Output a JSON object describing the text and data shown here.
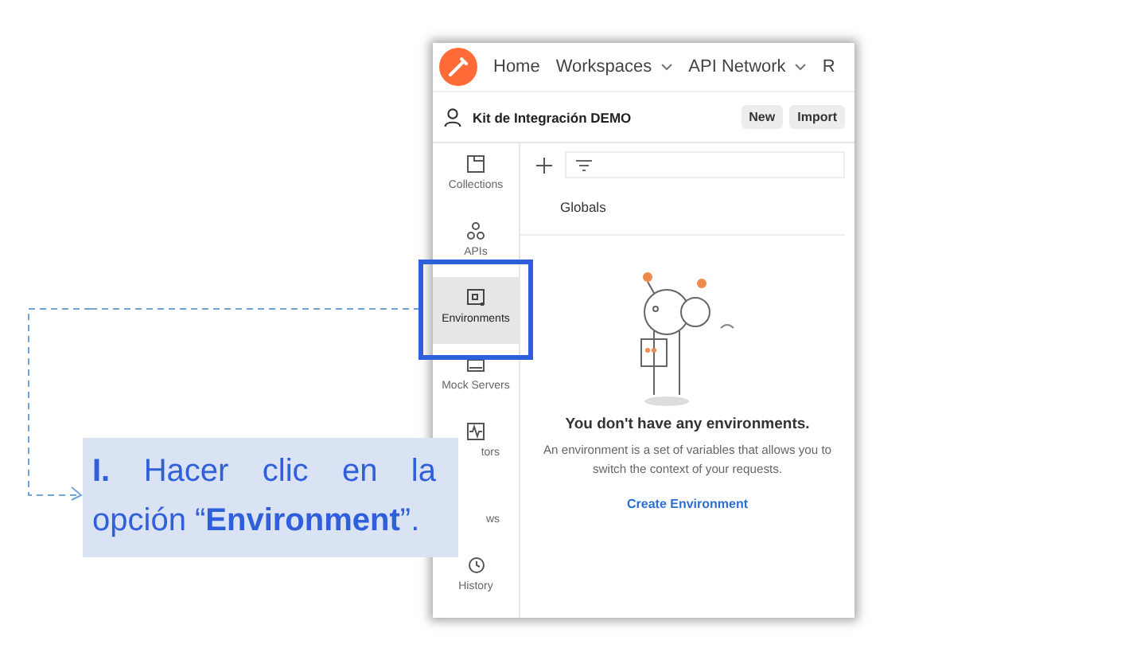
{
  "nav": [
    {
      "label": "Home",
      "dropdown": false
    },
    {
      "label": "Workspaces",
      "dropdown": true
    },
    {
      "label": "API Network",
      "dropdown": true
    },
    {
      "label": "R",
      "dropdown": false
    }
  ],
  "workspace": {
    "name": "Kit de Integración DEMO",
    "buttons": [
      "New",
      "Import"
    ]
  },
  "sidebar": {
    "items": [
      {
        "kind": "full",
        "label": "Collections",
        "selected": false
      },
      {
        "kind": "full",
        "label": "APIs",
        "selected": false
      },
      {
        "kind": "full",
        "label": "Environments",
        "selected": true
      },
      {
        "kind": "full",
        "label": "Mock Servers",
        "selected": false
      },
      {
        "kind": "partial",
        "label": "tors"
      },
      {
        "kind": "partial",
        "label": "ws"
      },
      {
        "kind": "full",
        "label": "History",
        "selected": false
      }
    ]
  },
  "list": {
    "items": [
      "Globals"
    ]
  },
  "empty_state": {
    "title": "You don't have any environments.",
    "text": "An environment is a set of variables that allows you to switch the context of your requests.",
    "action": "Create Environment"
  },
  "callout": {
    "text": "**I.** Hacer clic en la opción “**Environment**”."
  }
}
